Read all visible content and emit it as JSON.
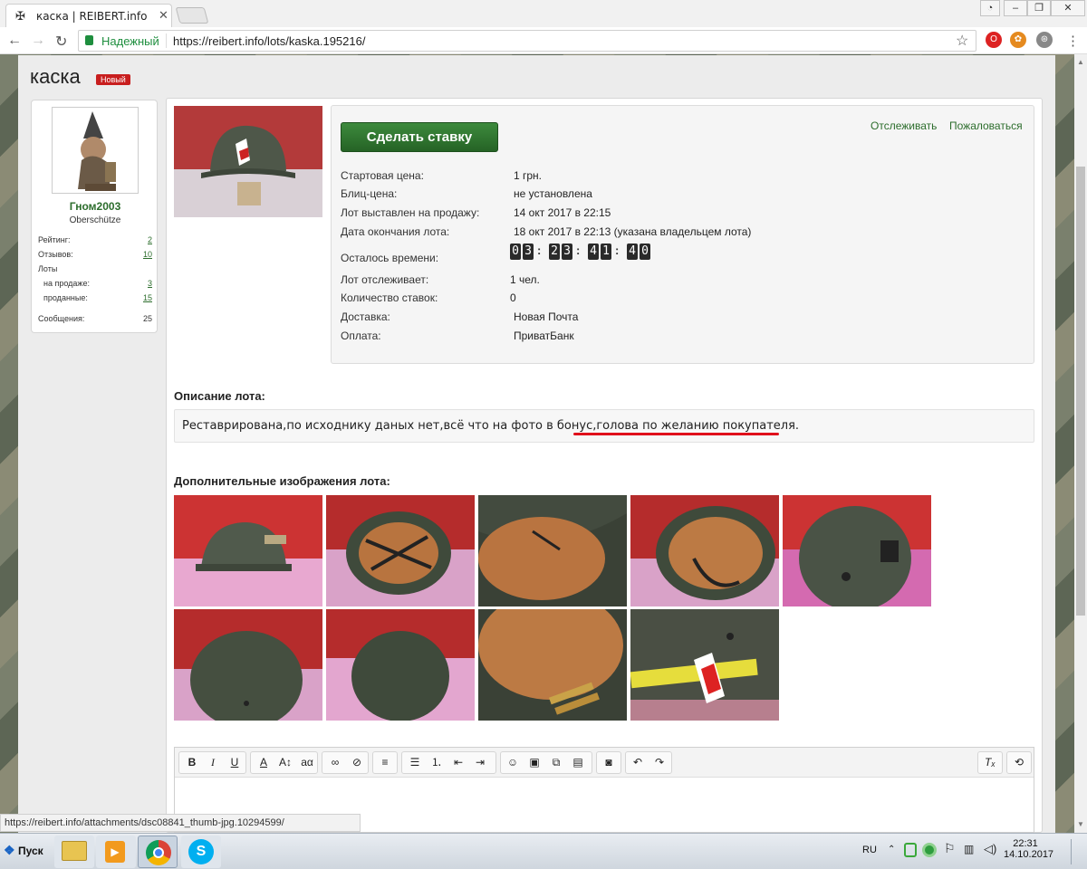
{
  "browser": {
    "tab_title": "каска | REIBERT.info",
    "secure_label": "Надежный",
    "url": "https://reibert.info/lots/kaska.195216/",
    "status_url": "https://reibert.info/attachments/dsc08841_thumb-jpg.10294599/"
  },
  "page": {
    "title": "каска",
    "new_badge": "Новый"
  },
  "seller": {
    "name": "Гном2003",
    "rank": "Oberschütze",
    "stats": [
      {
        "label": "Рейтинг:",
        "value": "2"
      },
      {
        "label": "Отзывов:",
        "value": "10"
      },
      {
        "label": "Лоты",
        "value": ""
      },
      {
        "label": "на продаже:",
        "value": "3"
      },
      {
        "label": "проданные:",
        "value": "15"
      },
      {
        "label": "Сообщения:",
        "value": "25"
      }
    ]
  },
  "lot": {
    "bid_button": "Сделать ставку",
    "watch_link": "Отслеживать",
    "report_link": "Пожаловаться",
    "fields": [
      {
        "label": "Стартовая цена:",
        "value": "1 грн."
      },
      {
        "label": "Блиц-цена:",
        "value": "не установлена"
      },
      {
        "label": "Лот выставлен на продажу:",
        "value": "14 окт 2017 в 22:15"
      },
      {
        "label": "Дата окончания лота:",
        "value": "18 окт 2017 в 22:13 (указана владельцем лота)"
      },
      {
        "label": "Осталось времени:",
        "value": ""
      },
      {
        "label": "Лот отслеживает:",
        "value": "1 чел."
      },
      {
        "label": "Количество ставок:",
        "value": "0"
      },
      {
        "label": "Доставка:",
        "value": "Новая Почта"
      },
      {
        "label": "Оплата:",
        "value": "ПриватБанк"
      }
    ],
    "timer_digits": [
      "0",
      "3",
      "2",
      "3",
      "4",
      "1",
      "4",
      "0"
    ],
    "description_heading": "Описание лота:",
    "description": "Реставрирована,по исходнику даных нет,всё что на фото в бонус,голова по желанию покупателя.",
    "additional_heading": "Дополнительные изображения лота:"
  },
  "taskbar": {
    "start": "Пуск",
    "lang": "RU",
    "time": "22:31",
    "date": "14.10.2017"
  },
  "colors": {
    "accent_green": "#2c6d2c",
    "button_green": "#2f7a2f",
    "badge_red": "#c81e1e",
    "underline_red": "#e0101b"
  }
}
